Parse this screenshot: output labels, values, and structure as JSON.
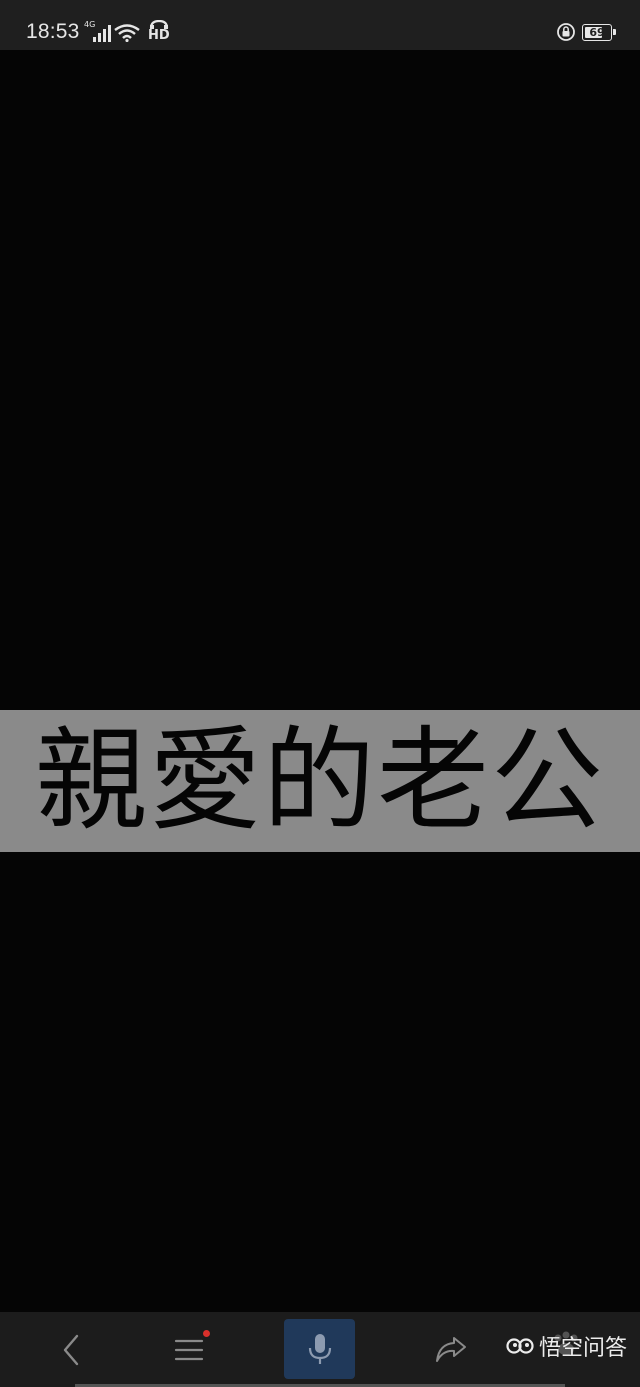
{
  "status_bar": {
    "time": "18:53",
    "network_type": "4G",
    "hd_label": "HD",
    "battery_level": "69",
    "icons": [
      "signal-icon",
      "wifi-icon",
      "hd-call-icon",
      "rotation-lock-icon",
      "battery-icon"
    ]
  },
  "video": {
    "subtitle": "親愛的老公"
  },
  "bottom_nav": {
    "items": [
      {
        "name": "back",
        "icon": "chevron-left-icon"
      },
      {
        "name": "menu",
        "icon": "hamburger-icon",
        "has_notification_dot": true
      },
      {
        "name": "voice",
        "icon": "microphone-icon",
        "active": true
      },
      {
        "name": "share",
        "icon": "share-arrow-icon"
      }
    ],
    "watermark": "悟空问答"
  },
  "colors": {
    "status_bar_bg": "#1f1f1f",
    "video_bg": "#050505",
    "subtitle_banner_bg": "#8a8a8a",
    "bottom_bar_bg": "#1c1c1c",
    "mic_button_bg": "#20395a",
    "notification_dot": "#d9302b"
  }
}
